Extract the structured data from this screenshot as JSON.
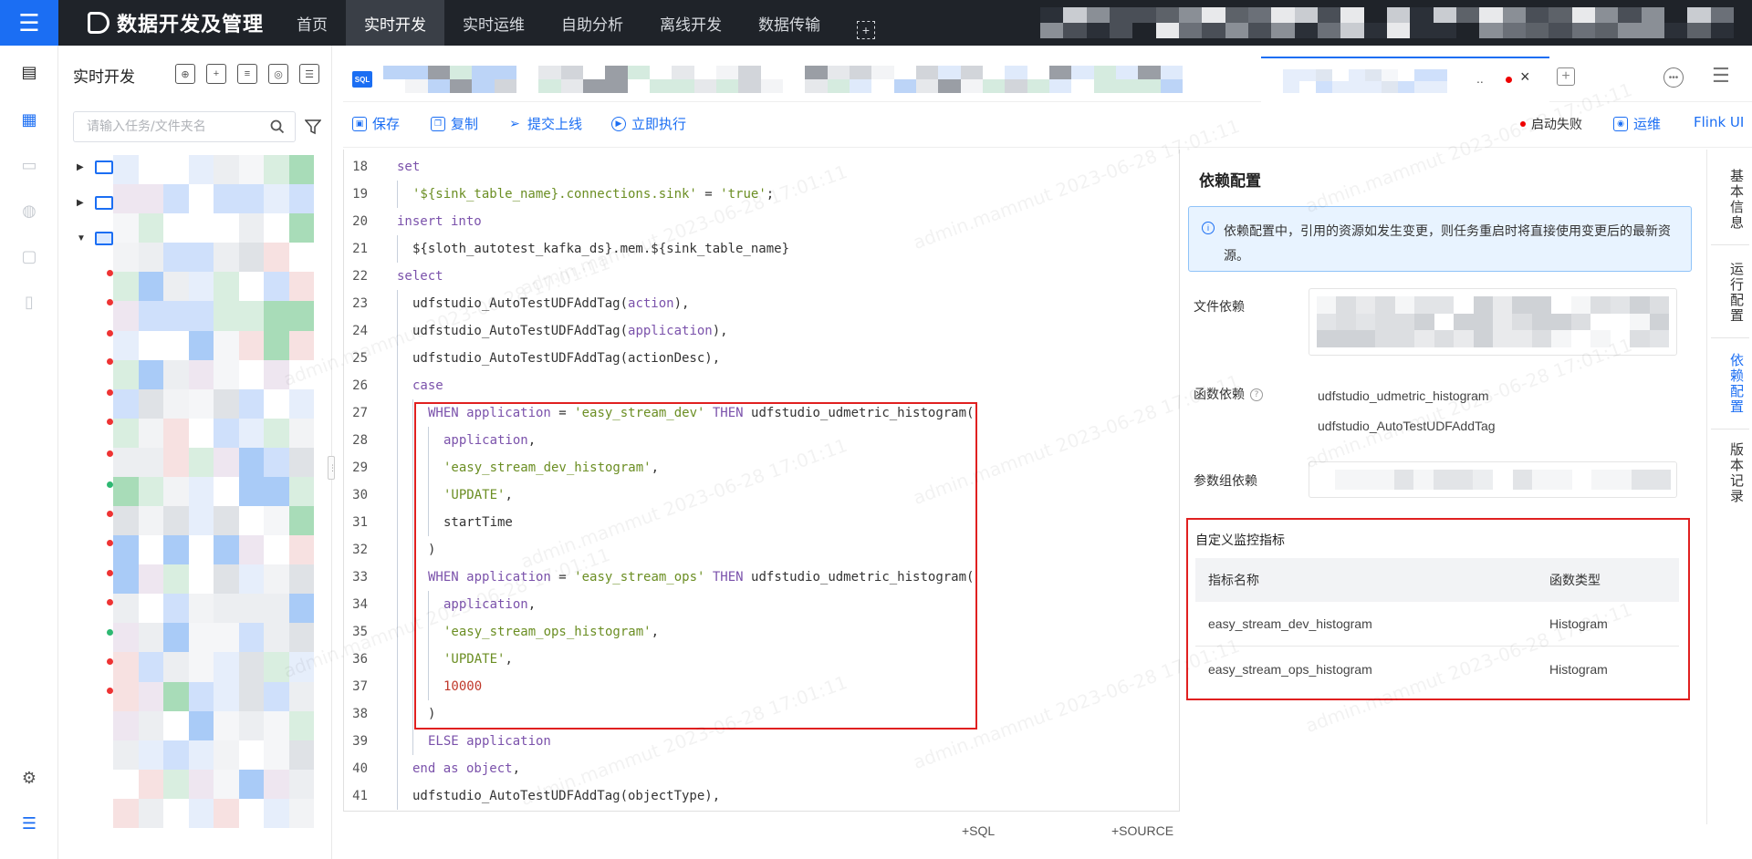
{
  "topbar": {
    "app_title": "数据开发及管理",
    "nav": [
      "首页",
      "实时开发",
      "实时运维",
      "自助分析",
      "离线开发",
      "数据传输"
    ],
    "active_nav": "实时开发"
  },
  "tree_panel": {
    "title": "实时开发",
    "search_placeholder": "请输入任务/文件夹名"
  },
  "tabs": {
    "sql_icon_text": "SQL",
    "more_text": "..",
    "close_glyph": "×"
  },
  "toolbar": {
    "save": "保存",
    "copy": "复制",
    "submit": "提交上线",
    "run": "立即执行",
    "status": "启动失败",
    "ops": "运维",
    "flink_ui": "Flink UI"
  },
  "editor": {
    "lines": [
      {
        "n": "18",
        "indent": 0,
        "tokens": [
          [
            "kw",
            "set"
          ]
        ]
      },
      {
        "n": "19",
        "indent": 1,
        "tokens": [
          [
            "str",
            "'${sink_table_name}.connections.sink'"
          ],
          [
            "",
            " = "
          ],
          [
            "str",
            "'true'"
          ],
          [
            "",
            ";"
          ]
        ]
      },
      {
        "n": "20",
        "indent": 0,
        "tokens": [
          [
            "kw",
            "insert into"
          ]
        ]
      },
      {
        "n": "21",
        "indent": 1,
        "tokens": [
          [
            "",
            "${sloth_autotest_kafka_ds}.mem.${sink_table_name}"
          ]
        ]
      },
      {
        "n": "22",
        "indent": 0,
        "tokens": [
          [
            "kw",
            "select"
          ]
        ]
      },
      {
        "n": "23",
        "indent": 1,
        "tokens": [
          [
            "",
            "udfstudio_AutoTestUDFAddTag("
          ],
          [
            "kw",
            "action"
          ],
          [
            "",
            "),"
          ]
        ]
      },
      {
        "n": "24",
        "indent": 1,
        "tokens": [
          [
            "",
            "udfstudio_AutoTestUDFAddTag("
          ],
          [
            "kw",
            "application"
          ],
          [
            "",
            "),"
          ]
        ]
      },
      {
        "n": "25",
        "indent": 1,
        "tokens": [
          [
            "",
            "udfstudio_AutoTestUDFAddTag(actionDesc),"
          ]
        ]
      },
      {
        "n": "26",
        "indent": 1,
        "tokens": [
          [
            "kw",
            "case"
          ]
        ]
      },
      {
        "n": "27",
        "indent": 2,
        "tokens": [
          [
            "kw",
            "WHEN application"
          ],
          [
            "",
            " = "
          ],
          [
            "str",
            "'easy_stream_dev'"
          ],
          [
            "kw",
            " THEN"
          ],
          [
            "",
            " udfstudio_udmetric_histogram("
          ]
        ]
      },
      {
        "n": "28",
        "indent": 3,
        "tokens": [
          [
            "kw",
            "application"
          ],
          [
            "",
            ","
          ]
        ]
      },
      {
        "n": "29",
        "indent": 3,
        "tokens": [
          [
            "str",
            "'easy_stream_dev_histogram'"
          ],
          [
            "",
            ","
          ]
        ]
      },
      {
        "n": "30",
        "indent": 3,
        "tokens": [
          [
            "str",
            "'UPDATE'"
          ],
          [
            "",
            ","
          ]
        ]
      },
      {
        "n": "31",
        "indent": 3,
        "tokens": [
          [
            "",
            "startTime"
          ]
        ]
      },
      {
        "n": "32",
        "indent": 2,
        "tokens": [
          [
            "",
            ")"
          ]
        ]
      },
      {
        "n": "33",
        "indent": 2,
        "tokens": [
          [
            "kw",
            "WHEN application"
          ],
          [
            "",
            " = "
          ],
          [
            "str",
            "'easy_stream_ops'"
          ],
          [
            "kw",
            " THEN"
          ],
          [
            "",
            " udfstudio_udmetric_histogram("
          ]
        ]
      },
      {
        "n": "34",
        "indent": 3,
        "tokens": [
          [
            "kw",
            "application"
          ],
          [
            "",
            ","
          ]
        ]
      },
      {
        "n": "35",
        "indent": 3,
        "tokens": [
          [
            "str",
            "'easy_stream_ops_histogram'"
          ],
          [
            "",
            ","
          ]
        ]
      },
      {
        "n": "36",
        "indent": 3,
        "tokens": [
          [
            "str",
            "'UPDATE'"
          ],
          [
            "",
            ","
          ]
        ]
      },
      {
        "n": "37",
        "indent": 3,
        "tokens": [
          [
            "num",
            "10000"
          ]
        ]
      },
      {
        "n": "38",
        "indent": 2,
        "tokens": [
          [
            "",
            ")"
          ]
        ]
      },
      {
        "n": "39",
        "indent": 2,
        "tokens": [
          [
            "kw",
            "ELSE application"
          ]
        ]
      },
      {
        "n": "40",
        "indent": 1,
        "tokens": [
          [
            "kw",
            "end as object"
          ],
          [
            "",
            ","
          ]
        ]
      },
      {
        "n": "41",
        "indent": 1,
        "tokens": [
          [
            "",
            "udfstudio_AutoTestUDFAddTag(objectType),"
          ]
        ]
      }
    ],
    "add_sql": "+SQL",
    "add_source": "+SOURCE"
  },
  "dependency": {
    "title": "依赖配置",
    "info": "依赖配置中，引用的资源如发生变更，则任务重启时将直接使用变更后的最新资源。",
    "file_label": "文件依赖",
    "function_label": "函数依赖",
    "functions": [
      "udfstudio_udmetric_histogram",
      "udfstudio_AutoTestUDFAddTag"
    ],
    "param_label": "参数组依赖",
    "metrics_title": "自定义监控指标",
    "metrics_headers": [
      "指标名称",
      "函数类型"
    ],
    "metrics_rows": [
      [
        "easy_stream_dev_histogram",
        "Histogram"
      ],
      [
        "easy_stream_ops_histogram",
        "Histogram"
      ]
    ]
  },
  "side_tabs": [
    "基本信息",
    "运行配置",
    "依赖配置",
    "版本记录"
  ],
  "active_side_tab": "依赖配置",
  "watermark": "admin.mammut 2023-06-28 17:01:11",
  "colors": {
    "accent": "#1b6ef3",
    "topbar": "#1f2329",
    "highlight": "#e02020"
  }
}
